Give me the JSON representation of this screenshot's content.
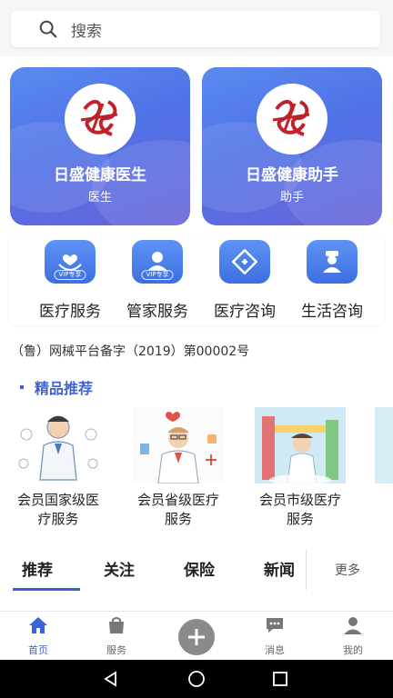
{
  "search": {
    "placeholder": "搜索"
  },
  "hero_cards": [
    {
      "title": "日盛健康医生",
      "subtitle": "医生"
    },
    {
      "title": "日盛健康助手",
      "subtitle": "助手"
    }
  ],
  "services": [
    {
      "label": "医疗服务",
      "tag": "VIP专享",
      "icon": "heart-hands-icon"
    },
    {
      "label": "管家服务",
      "tag": "VIP专享",
      "icon": "person-icon"
    },
    {
      "label": "医疗咨询",
      "icon": "medical-cross-icon"
    },
    {
      "label": "生活咨询",
      "icon": "nurse-icon"
    }
  ],
  "record_text": "（鲁）网械平台备字（2019）第00002号",
  "section": {
    "title": "精品推荐"
  },
  "products": [
    {
      "line1": "会员国家级医",
      "line2": "疗服务"
    },
    {
      "line1": "会员省级医疗",
      "line2": "服务"
    },
    {
      "line1": "会员市级医疗",
      "line2": "服务"
    }
  ],
  "tabs": [
    {
      "label": "推荐",
      "active": true
    },
    {
      "label": "关注"
    },
    {
      "label": "保险"
    },
    {
      "label": "新闻"
    }
  ],
  "more_label": "更多",
  "bottom_nav": [
    {
      "label": "首页",
      "icon": "home-icon",
      "active": true
    },
    {
      "label": "服务",
      "icon": "bag-icon"
    },
    {
      "label": "消息",
      "icon": "chat-icon"
    },
    {
      "label": "我的",
      "icon": "user-icon"
    }
  ],
  "colors": {
    "accent": "#3c62d8",
    "hero_start": "#5a8af0",
    "hero_end": "#6a63d9"
  }
}
